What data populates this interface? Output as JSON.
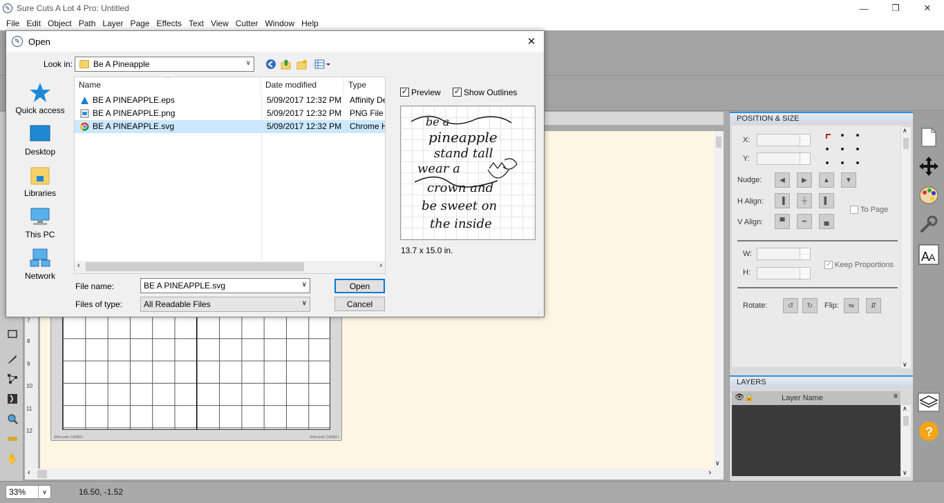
{
  "window": {
    "title": "Sure Cuts A Lot 4 Pro: Untitled",
    "controls": {
      "minimize": "—",
      "restore": "❐",
      "close": "✕"
    }
  },
  "menu": [
    "File",
    "Edit",
    "Object",
    "Path",
    "Layer",
    "Page",
    "Effects",
    "Text",
    "View",
    "Cutter",
    "Window",
    "Help"
  ],
  "ruler_numbers": [
    "7",
    "8",
    "9",
    "10",
    "11",
    "12"
  ],
  "mat": {
    "left_label": "Silhouette CAMEO",
    "right_label": "Silhouette CAMEO"
  },
  "position_panel": {
    "title": "POSITION & SIZE",
    "x_label": "X:",
    "y_label": "Y:",
    "nudge_label": "Nudge:",
    "h_align_label": "H Align:",
    "v_align_label": "V Align:",
    "to_page_label": "To Page",
    "w_label": "W:",
    "h_label": "H:",
    "keep_proportions_label": "Keep Proportions",
    "rotate_label": "Rotate:",
    "flip_label": "Flip:"
  },
  "layers_panel": {
    "title": "LAYERS",
    "column": "Layer Name"
  },
  "statusbar": {
    "zoom": "33%",
    "coords": "16.50, -1.52"
  },
  "dialog": {
    "title": "Open",
    "look_in_label": "Look in:",
    "look_in_value": "Be A Pineapple",
    "places": [
      "Quick access",
      "Desktop",
      "Libraries",
      "This PC",
      "Network"
    ],
    "columns": [
      "Name",
      "Date modified",
      "Type"
    ],
    "files": [
      {
        "name": "BE A PINEAPPLE.eps",
        "date": "5/09/2017 12:32 PM",
        "type": "Affinity De",
        "icon": "affinity-icon",
        "selected": false
      },
      {
        "name": "BE A PINEAPPLE.png",
        "date": "5/09/2017 12:32 PM",
        "type": "PNG File",
        "icon": "image-file-icon",
        "selected": false
      },
      {
        "name": "BE A PINEAPPLE.svg",
        "date": "5/09/2017 12:32 PM",
        "type": "Chrome H",
        "icon": "chrome-icon",
        "selected": true
      }
    ],
    "preview_label": "Preview",
    "preview_checked": true,
    "show_outlines_label": "Show Outlines",
    "show_outlines_checked": true,
    "preview_text": [
      "be a",
      "pineapple",
      "stand tall",
      "wear a",
      "crown and",
      "be sweet on",
      "the inside"
    ],
    "dimensions": "13.7 x 15.0 in.",
    "file_name_label": "File name:",
    "file_name_value": "BE A PINEAPPLE.svg",
    "files_of_type_label": "Files of type:",
    "files_of_type_value": "All Readable Files",
    "open_button": "Open",
    "cancel_button": "Cancel"
  }
}
